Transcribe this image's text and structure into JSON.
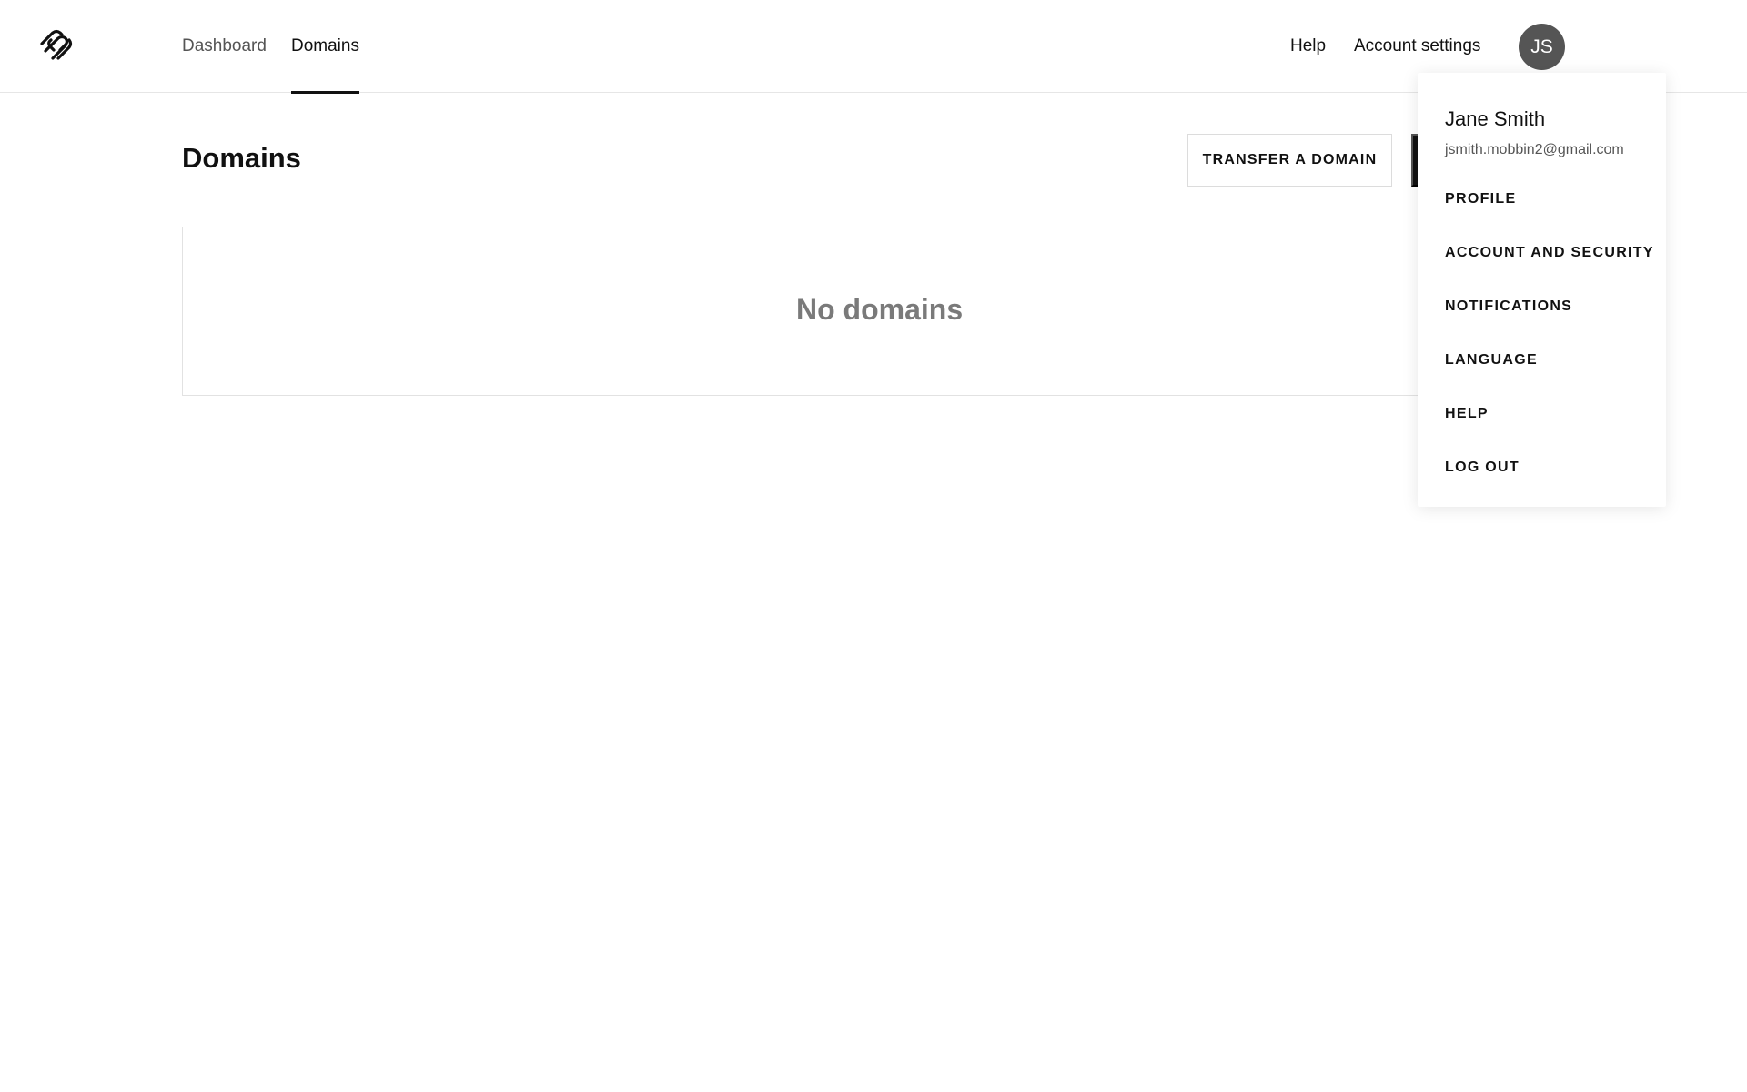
{
  "nav": {
    "logo_icon": "squarespace-logo-icon",
    "tabs": [
      {
        "label": "Dashboard",
        "active": false
      },
      {
        "label": "Domains",
        "active": true
      }
    ],
    "help_label": "Help",
    "account_settings_label": "Account settings",
    "avatar_initials": "JS"
  },
  "main": {
    "title": "Domains",
    "transfer_button_label": "TRANSFER A DOMAIN",
    "empty_state_text": "No domains"
  },
  "account_menu": {
    "user_name": "Jane Smith",
    "user_email": "jsmith.mobbin2@gmail.com",
    "items": [
      {
        "label": "PROFILE"
      },
      {
        "label": "ACCOUNT AND SECURITY"
      },
      {
        "label": "NOTIFICATIONS"
      },
      {
        "label": "LANGUAGE"
      },
      {
        "label": "HELP"
      },
      {
        "label": "LOG OUT"
      }
    ]
  },
  "colors": {
    "text": "#111111",
    "muted": "#555555",
    "empty_text": "#7a7a7a",
    "avatar_bg": "#555555",
    "primary_button": "#111111"
  }
}
